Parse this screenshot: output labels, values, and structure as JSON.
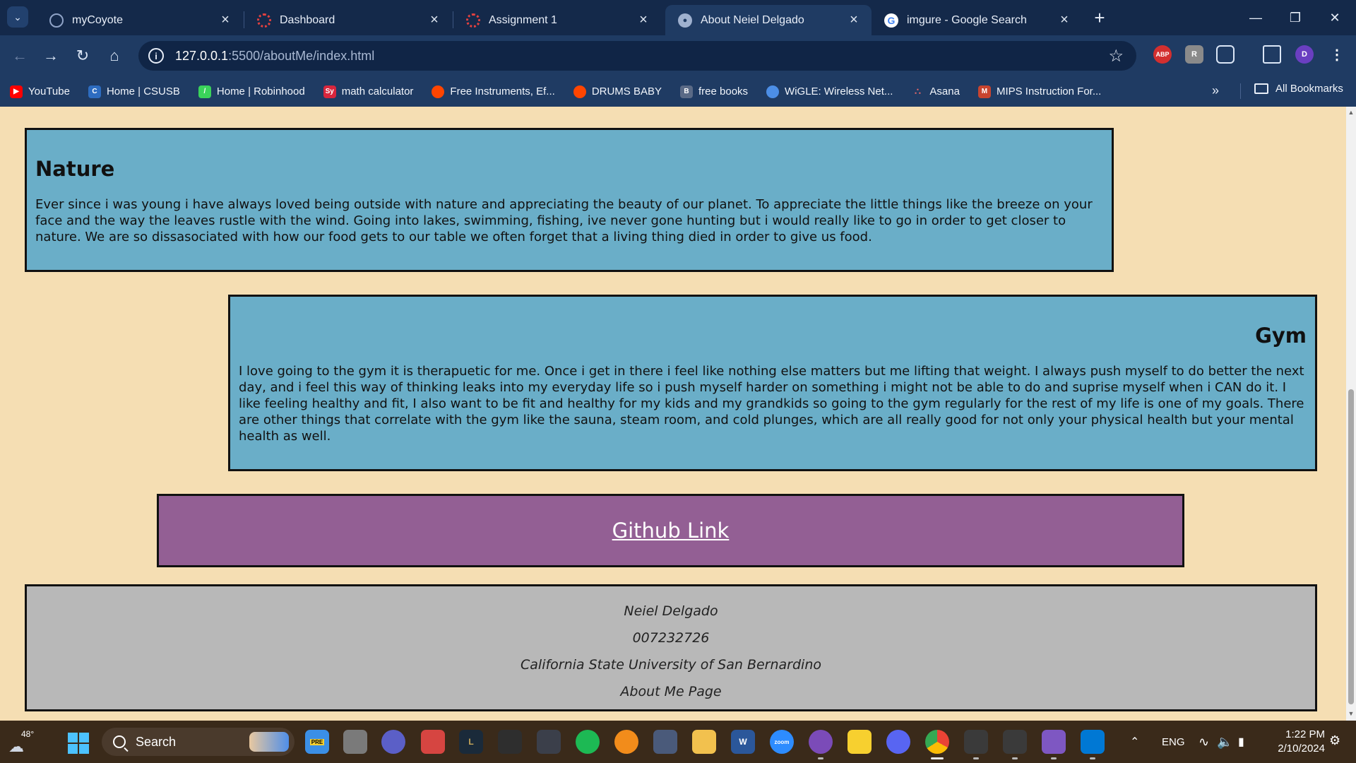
{
  "browser": {
    "tabs": [
      {
        "title": "myCoyote",
        "active": false,
        "icon": "mycoyote-icon",
        "color": "#8fa3c7"
      },
      {
        "title": "Dashboard",
        "active": false,
        "icon": "canvas-icon",
        "color": "#e4413f"
      },
      {
        "title": "Assignment 1",
        "active": false,
        "icon": "canvas-icon",
        "color": "#e4413f"
      },
      {
        "title": "About Neiel Delgado",
        "active": true,
        "icon": "globe-icon",
        "color": "#9fb1cf"
      },
      {
        "title": "imgure - Google Search",
        "active": false,
        "icon": "google-icon",
        "color": "#ffffff"
      }
    ],
    "url": {
      "host": "127.0.0.1",
      "path": ":5500/aboutMe/index.html"
    },
    "profile_initial": "D",
    "bookmarks": [
      {
        "label": "YouTube",
        "icon": "youtube-icon",
        "color": "#ff0000"
      },
      {
        "label": "Home | CSUSB",
        "icon": "csusb-icon",
        "color": "#2d6cc0"
      },
      {
        "label": "Home | Robinhood",
        "icon": "robinhood-icon",
        "color": "#3ad35a"
      },
      {
        "label": "math calculator",
        "icon": "symbolab-icon",
        "color": "#d7263d"
      },
      {
        "label": "Free Instruments, Ef...",
        "icon": "reddit-icon",
        "color": "#ff4500"
      },
      {
        "label": "DRUMS BABY",
        "icon": "reddit-icon",
        "color": "#ff4500"
      },
      {
        "label": "free books",
        "icon": "book-icon",
        "color": "#5a6a86"
      },
      {
        "label": "WiGLE: Wireless Net...",
        "icon": "wigle-icon",
        "color": "#4c8ee6"
      },
      {
        "label": "Asana",
        "icon": "asana-icon",
        "color": "#f06a6a"
      },
      {
        "label": "MIPS Instruction For...",
        "icon": "mips-icon",
        "color": "#c8442f"
      }
    ],
    "all_bookmarks": "All Bookmarks"
  },
  "page": {
    "nature": {
      "title": "Nature",
      "body": "Ever since i was young i have always loved being outside with nature and appreciating the beauty of our planet. To appreciate the little things like the breeze on your face and the way the leaves rustle with the wind. Going into lakes, swimming, fishing, ive never gone hunting but i would really like to go in order to get closer to nature. We are so dissasociated with how our food gets to our table we often forget that a living thing died in order to give us food."
    },
    "gym": {
      "title": "Gym",
      "body": "I love going to the gym it is therapuetic for me. Once i get in there i feel like nothing else matters but me lifting that weight. I always push myself to do better the next day, and i feel this way of thinking leaks into my everyday life so i push myself harder on something i might not be able to do and suprise myself when i CAN do it. I like feeling healthy and fit, I also want to be fit and healthy for my kids and my grandkids so going to the gym regularly for the rest of my life is one of my goals. There are other things that correlate with the gym like the sauna, steam room, and cold plunges, which are all really good for not only your physical health but your mental health as well."
    },
    "github_link": "Github Link",
    "footer": {
      "name": "Neiel Delgado",
      "id": "007232726",
      "school": "California State University of San Bernardino",
      "page": "About Me Page"
    },
    "colors": {
      "background": "#f5deb3",
      "section": "#6aaec8",
      "github": "#935f94",
      "footer": "#b8b8b8"
    }
  },
  "taskbar": {
    "temperature": "48°",
    "search_placeholder": "Search",
    "language": "ENG",
    "time": "1:22 PM",
    "date": "2/10/2024",
    "apps": [
      {
        "name": "copilot-icon",
        "color": "#3b8fe6",
        "label": "PRE"
      },
      {
        "name": "task-view-icon",
        "color": "#7a7a7a",
        "label": ""
      },
      {
        "name": "meet-icon",
        "color": "#5b5fc7",
        "label": ""
      },
      {
        "name": "popcorn-icon",
        "color": "#d64541",
        "label": ""
      },
      {
        "name": "league-icon",
        "color": "#1a2a3a",
        "label": "L"
      },
      {
        "name": "minecraft-icon",
        "color": "#2e2e2e",
        "label": ""
      },
      {
        "name": "game-icon",
        "color": "#3b3f4a",
        "label": ""
      },
      {
        "name": "spotify-icon",
        "color": "#1db954",
        "label": ""
      },
      {
        "name": "fl-studio-icon",
        "color": "#f28c1b",
        "label": ""
      },
      {
        "name": "calculator-icon",
        "color": "#4a5a7a",
        "label": ""
      },
      {
        "name": "file-explorer-icon",
        "color": "#f2c14e",
        "label": ""
      },
      {
        "name": "word-icon",
        "color": "#2b579a",
        "label": "W"
      },
      {
        "name": "zoom-icon",
        "color": "#2d8cff",
        "label": "zoom"
      },
      {
        "name": "github-desktop-icon",
        "color": "#7b4bb8",
        "label": ""
      },
      {
        "name": "sticky-notes-icon",
        "color": "#f7d02f",
        "label": ""
      },
      {
        "name": "discord-icon",
        "color": "#5865f2",
        "label": ""
      },
      {
        "name": "chrome-icon",
        "color": "#4285f4",
        "label": ""
      },
      {
        "name": "unity-icon",
        "color": "#3a3a3a",
        "label": ""
      },
      {
        "name": "unity-hub-icon",
        "color": "#3a3a3a",
        "label": ""
      },
      {
        "name": "visual-studio-icon",
        "color": "#7e57c2",
        "label": ""
      },
      {
        "name": "vscode-icon",
        "color": "#0078d4",
        "label": ""
      }
    ]
  }
}
